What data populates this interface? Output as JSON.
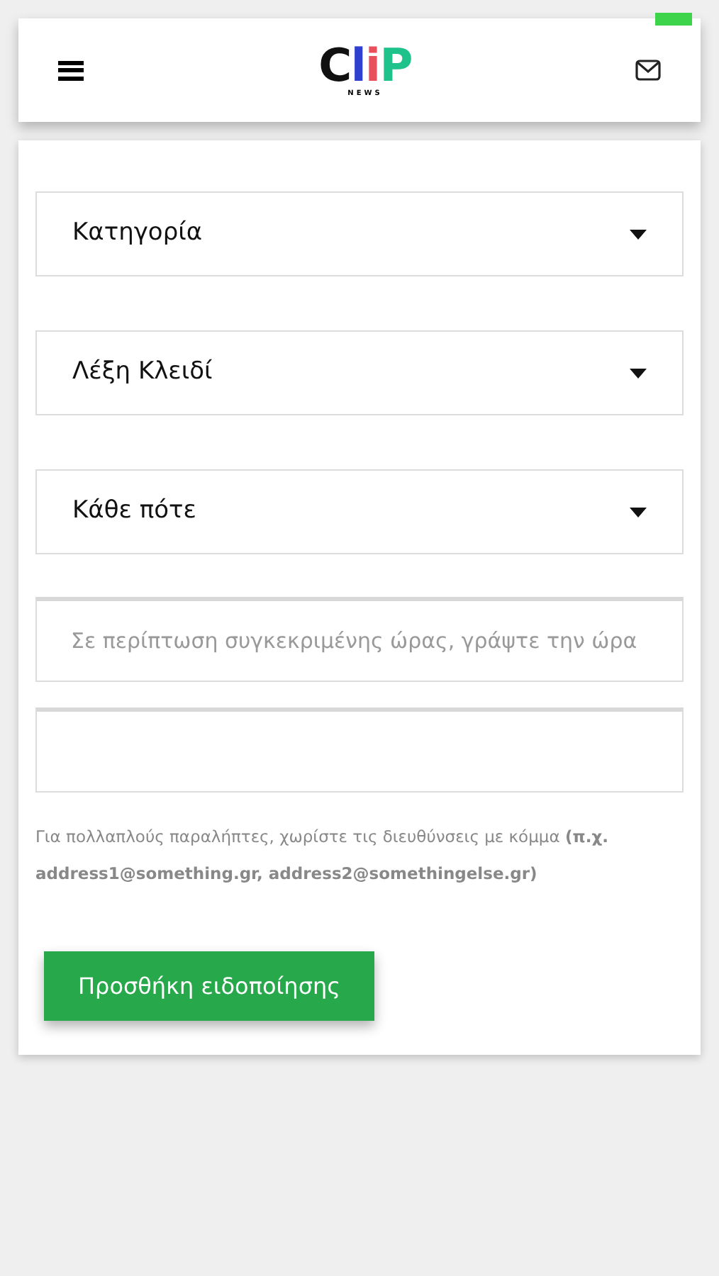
{
  "header": {
    "logo": {
      "letters": [
        {
          "text": "C",
          "color": "#111111"
        },
        {
          "text": "l",
          "color": "#2f3fd0"
        },
        {
          "text": "i",
          "color": "#e8505b"
        },
        {
          "text": "P",
          "color": "#1fc28a"
        }
      ],
      "subtitle": "NEWS"
    }
  },
  "form": {
    "dropdowns": [
      {
        "label": "Κατηγορία"
      },
      {
        "label": "Λέξη Κλειδί"
      },
      {
        "label": "Κάθε πότε"
      }
    ],
    "time_field": {
      "placeholder": "Σε περίπτωση συγκεκριμένης ώρας, γράψτε την ώρα"
    },
    "hint": "Για πολλαπλούς παραλήπτες, χωρίστε τις διευθύνσεις με κόμμα **(π.χ. address1@something.gr, address2@somethingelse.gr)**",
    "submit": "Προσθήκη ειδοποίησης"
  }
}
